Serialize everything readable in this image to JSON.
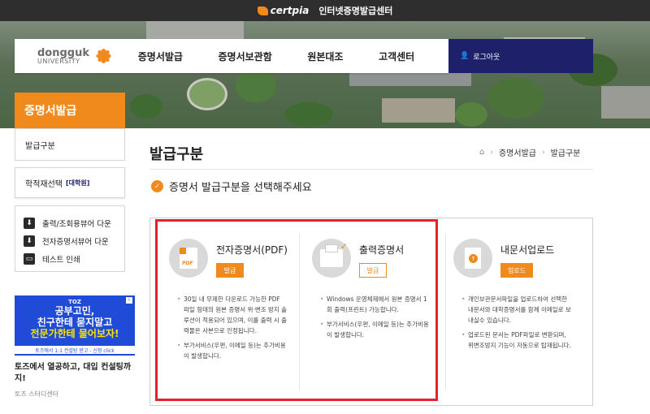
{
  "topbar": {
    "brand": "certpia",
    "title": "인터넷증명발급센터"
  },
  "logo": {
    "line1": "dongguk",
    "line2": "UNIVERSITY"
  },
  "nav": {
    "items": [
      "증명서발급",
      "증명서보관함",
      "원본대조",
      "고객센터"
    ],
    "login": "로그아웃"
  },
  "sidebar": {
    "heading": "증명서발급",
    "item1": "발급구분",
    "item2": "학적재선택",
    "item2_tag": "[대학원]",
    "links": [
      "출력/조회용뷰어 다운",
      "전자증명서뷰어 다운",
      "테스트 인쇄"
    ]
  },
  "ad": {
    "brand": "TOZ",
    "line1": "공부고민,",
    "line2": "친구한테 묻지말고",
    "line3": "전문가한테 물어보자!",
    "strip": "토즈에서 1:1 컨설팅 받고 - 신청 click",
    "text": "토즈에서 열공하고, 대입 컨설팅까지!",
    "source": "토즈 스터디센터"
  },
  "main": {
    "title": "발급구분",
    "breadcrumb": [
      "증명서발급",
      "발급구분"
    ],
    "subtitle": "증명서 발급구분을 선택해주세요"
  },
  "cards": [
    {
      "title": "전자증명서(PDF)",
      "button": "발급",
      "notes": [
        "30일 내 무제한 다운로드 가능한 PDF 파일 형태의 원본 증명서 위·변조 방지 솔루션이 적용되어 있으며, 이를 출력 시 출력물은 사본으로 인정됩니다.",
        "부가서비스(우편, 이메일 등)는 추가비용이 발생합니다."
      ]
    },
    {
      "title": "출력증명서",
      "button": "발급",
      "notes": [
        "Windows 운영체제에서 원본 증명서 1회 출력(프린트) 가능합니다.",
        "부가서비스(우편, 이메일 등)는 추가비용이 발생합니다."
      ]
    },
    {
      "title": "내문서업로드",
      "button": "업로드",
      "notes": [
        "개인보관문서파일을 업로드하여 선택한 내문서와 대학증명서를 함께 이메일로 보내실수 있습니다.",
        "업로드된 문서는 PDF파일로 변환되며, 위변조방지 기능이 자동으로 탑재됩니다."
      ]
    }
  ],
  "colors": {
    "accent": "#f08a1c",
    "navy": "#1e2069",
    "highlight": "#e0232e"
  }
}
